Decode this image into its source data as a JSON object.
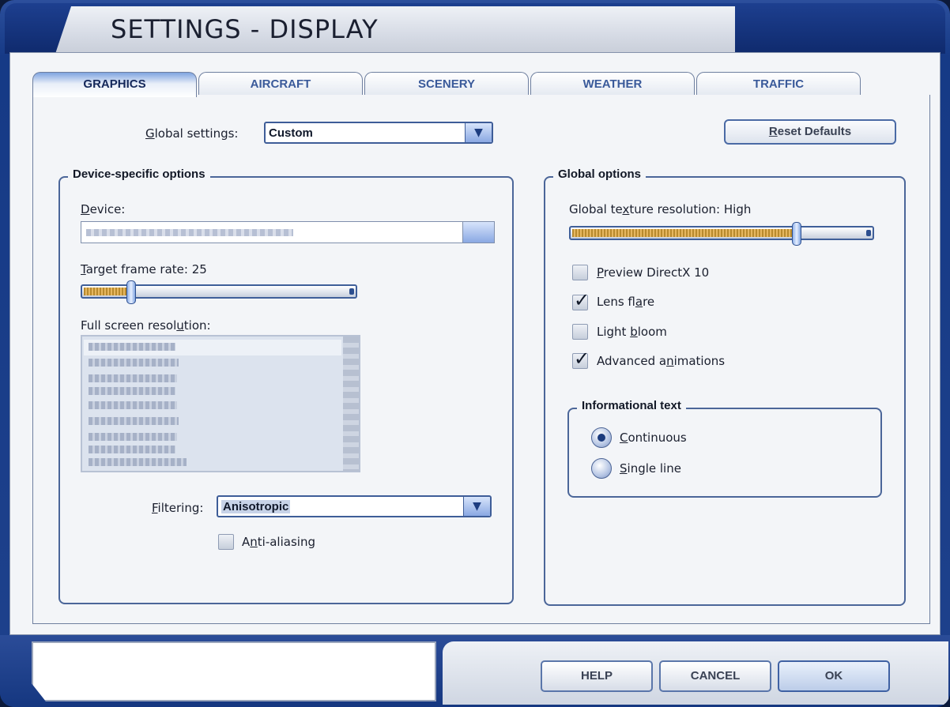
{
  "window": {
    "title": "SETTINGS - DISPLAY"
  },
  "tabs": [
    {
      "label": "GRAPHICS",
      "active": true
    },
    {
      "label": "AIRCRAFT",
      "active": false
    },
    {
      "label": "SCENERY",
      "active": false
    },
    {
      "label": "WEATHER",
      "active": false
    },
    {
      "label": "TRAFFIC",
      "active": false
    }
  ],
  "global_settings": {
    "label_prefix": "",
    "label_underlined": "G",
    "label_rest": "lobal settings:",
    "value": "Custom"
  },
  "reset_button": {
    "underlined": "R",
    "rest": "eset Defaults"
  },
  "device_group": {
    "title": "Device-specific options",
    "device_label_underlined": "D",
    "device_label_rest": "evice:",
    "target_label_underlined": "T",
    "target_label_rest": "arget frame rate: 25",
    "target_frame_rate": 25,
    "target_slider_fraction": 0.17,
    "resolution_label_prefix": "Full screen resol",
    "resolution_label_underlined": "u",
    "resolution_label_rest": "tion:",
    "filtering_label_underlined": "F",
    "filtering_label_rest": "iltering:",
    "filtering_value": "Anisotropic",
    "antialias_label_prefix": "A",
    "antialias_label_underlined": "n",
    "antialias_label_rest": "ti-aliasing",
    "antialias_checked": false
  },
  "global_group": {
    "title": "Global options",
    "texture_label_prefix": "Global te",
    "texture_label_underlined": "x",
    "texture_label_rest": "ture resolution: High",
    "texture_slider_fraction": 0.76,
    "options": [
      {
        "prefix": "",
        "underlined": "P",
        "rest": "review DirectX 10",
        "checked": false
      },
      {
        "prefix": "Lens fl",
        "underlined": "a",
        "rest": "re",
        "checked": true
      },
      {
        "prefix": "Light ",
        "underlined": "b",
        "rest": "loom",
        "checked": false
      },
      {
        "prefix": "Advanced a",
        "underlined": "n",
        "rest": "imations",
        "checked": true
      }
    ],
    "info_text": {
      "title": "Informational text",
      "options": [
        {
          "underlined": "C",
          "rest": "ontinuous",
          "selected": true
        },
        {
          "underlined": "S",
          "rest": "ingle line",
          "selected": false
        }
      ]
    }
  },
  "footer": {
    "help": "HELP",
    "cancel": "CANCEL",
    "ok": "OK"
  },
  "colors": {
    "frame_blue": "#1e418c",
    "panel_bg": "#f3f5f8",
    "accent_border": "#3e5d98",
    "slider_fill": "#e6b760"
  }
}
